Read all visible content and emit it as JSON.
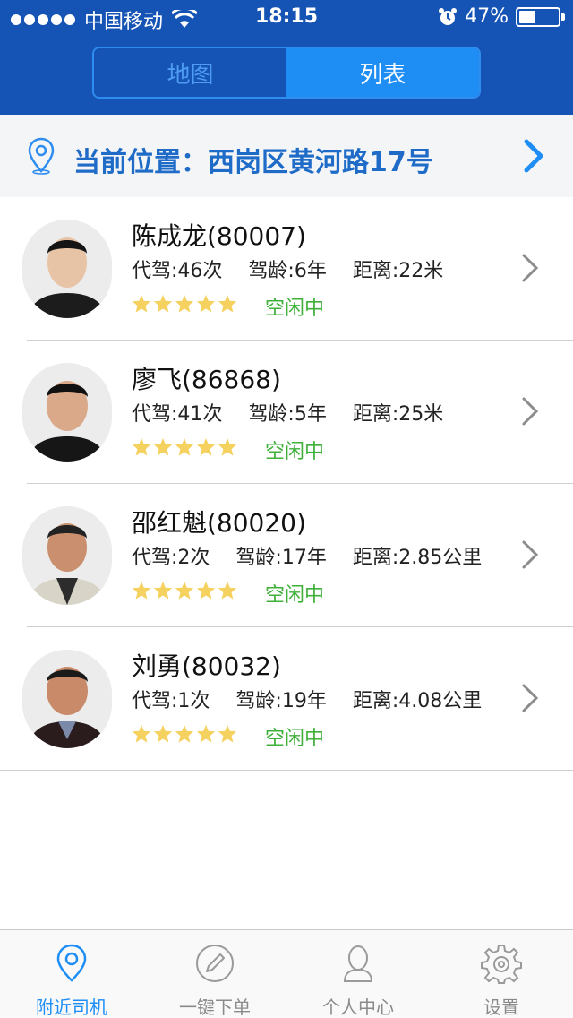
{
  "status_bar": {
    "carrier": "中国移动",
    "time": "18:15",
    "battery": "47%",
    "battery_level": 0.47
  },
  "segment": {
    "tabs": [
      {
        "label": "地图",
        "active": false
      },
      {
        "label": "列表",
        "active": true
      }
    ]
  },
  "location": {
    "label": "当前位置：西岗区黄河路17号"
  },
  "drivers": [
    {
      "name": "陈成龙(80007)",
      "trips": "代驾:46次",
      "years": "驾龄:6年",
      "distance": "距离:22米",
      "rating": 5,
      "status": "空闲中"
    },
    {
      "name": "廖飞(86868)",
      "trips": "代驾:41次",
      "years": "驾龄:5年",
      "distance": "距离:25米",
      "rating": 5,
      "status": "空闲中"
    },
    {
      "name": "邵红魁(80020)",
      "trips": "代驾:2次",
      "years": "驾龄:17年",
      "distance": "距离:2.85公里",
      "rating": 5,
      "status": "空闲中"
    },
    {
      "name": "刘勇(80032)",
      "trips": "代驾:1次",
      "years": "驾龄:19年",
      "distance": "距离:4.08公里",
      "rating": 5,
      "status": "空闲中"
    }
  ],
  "tabbar": {
    "items": [
      {
        "label": "附近司机",
        "icon": "location-pin-icon",
        "active": true
      },
      {
        "label": "一键下单",
        "icon": "pencil-icon",
        "active": false
      },
      {
        "label": "个人中心",
        "icon": "person-icon",
        "active": false
      },
      {
        "label": "设置",
        "icon": "gear-icon",
        "active": false
      }
    ]
  },
  "colors": {
    "header_blue": "#1553b4",
    "accent_blue": "#1e8ef5",
    "location_text": "#1e6bc8",
    "status_green": "#3fb03a",
    "star_yellow": "#f5d160"
  }
}
